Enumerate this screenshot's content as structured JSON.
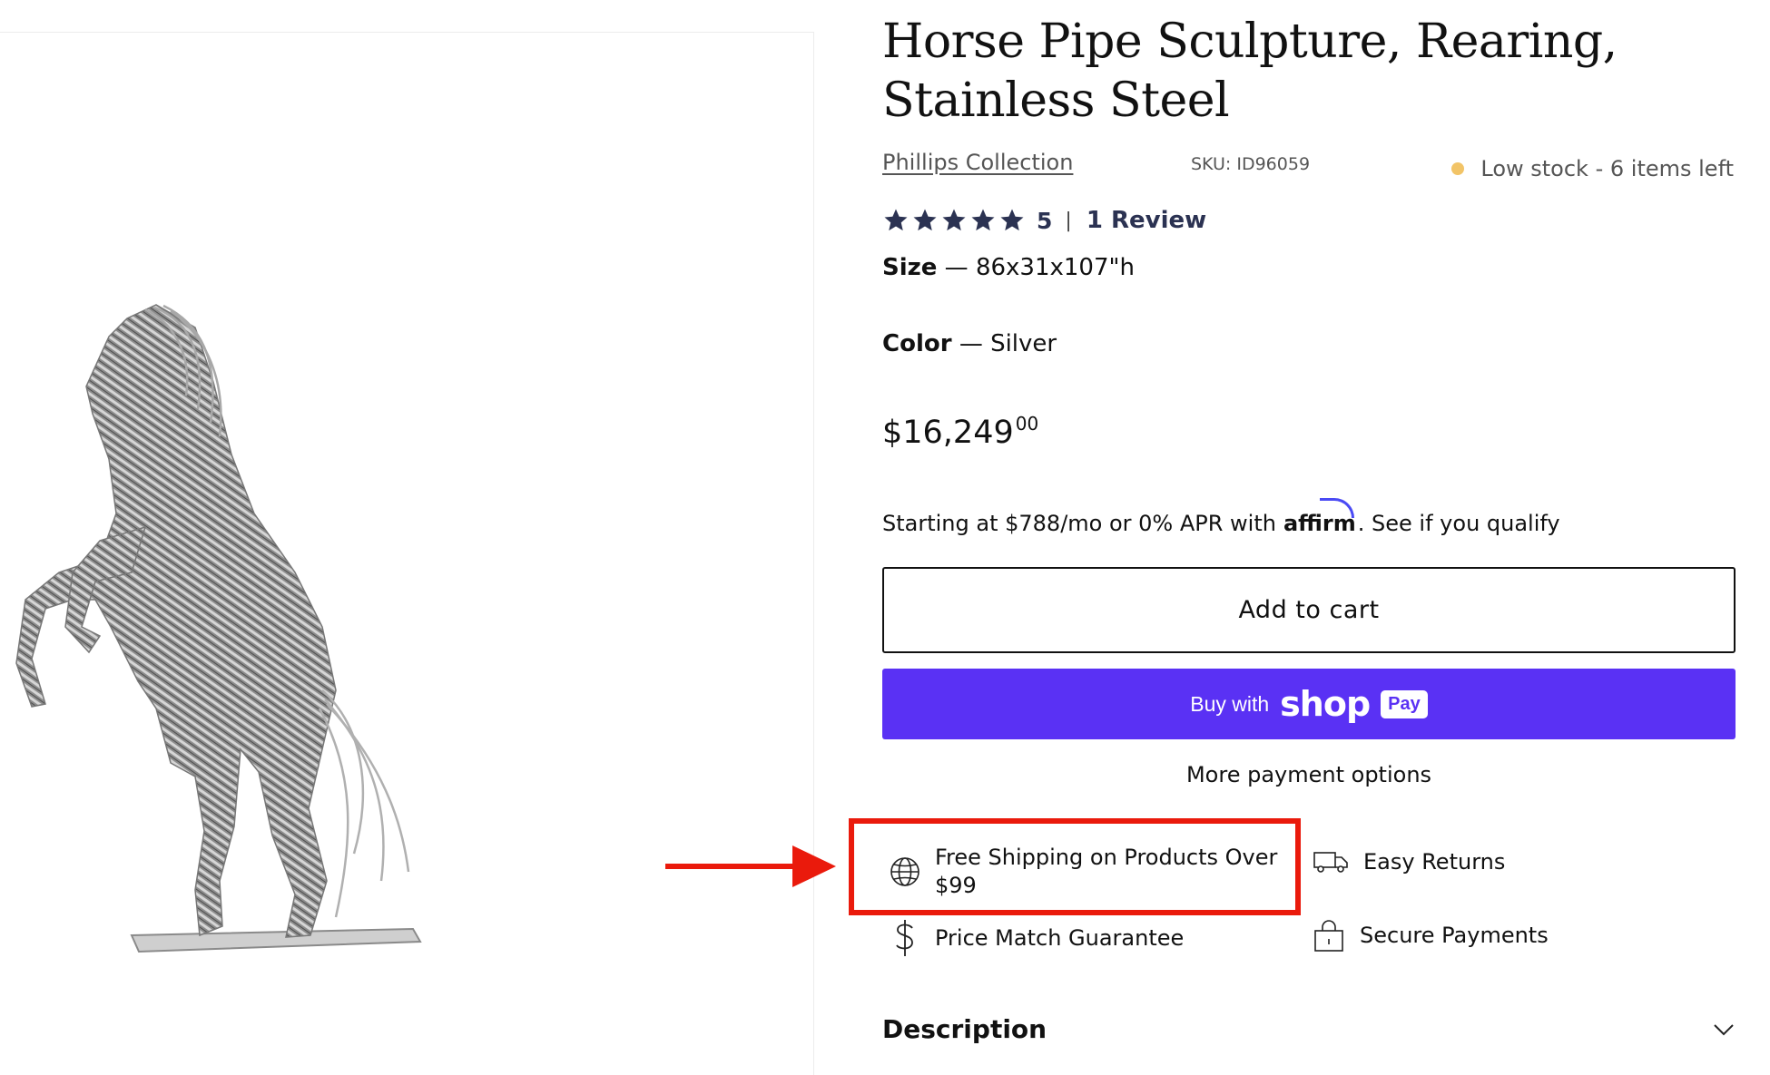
{
  "product": {
    "title": "Horse Pipe Sculpture, Rearing, Stainless Steel",
    "vendor": "Phillips Collection",
    "sku": "SKU: ID96059",
    "stock": "Low stock - 6 items left",
    "rating": {
      "stars": 5,
      "value": "5",
      "separator": "|",
      "reviews": "1 Review"
    },
    "options": [
      {
        "label": "Size",
        "separator": "—",
        "value": "86x31x107\"h"
      },
      {
        "label": "Color",
        "separator": "—",
        "value": "Silver"
      }
    ],
    "price": {
      "main": "$16,249",
      "cents": "00"
    }
  },
  "financing": {
    "text": "Starting at $788/mo or 0% APR with",
    "affirm": "affirm",
    "link": ". See if you qualify"
  },
  "buttons": {
    "add_to_cart": "Add to cart",
    "buy_with": "Buy with",
    "shop": "shop",
    "pay": "Pay",
    "more_options": "More payment options"
  },
  "features": [
    {
      "label": "Free Shipping on Products Over $99",
      "icon": "globe-icon"
    },
    {
      "label": "Easy Returns",
      "icon": "truck-icon"
    },
    {
      "label": "Price Match Guarantee",
      "icon": "dollar-icon"
    },
    {
      "label": "Secure Payments",
      "icon": "lock-bag-icon"
    }
  ],
  "description": {
    "title": "Description"
  },
  "colors": {
    "shop_pay": "#5a31f4",
    "highlight": "#ea1a0c",
    "stock_dot": "#f2c467",
    "stars": "#2b3252"
  }
}
